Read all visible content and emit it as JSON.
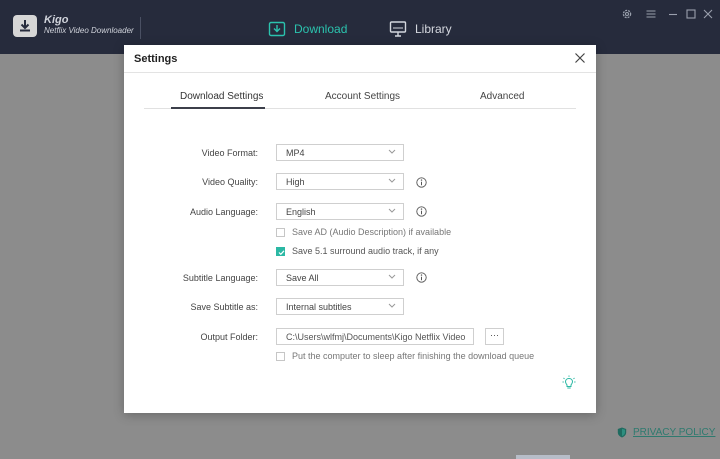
{
  "app": {
    "brand_name": "Kigo",
    "brand_subtitle": "Netflix Video Downloader",
    "accent_color": "#2bc3ae"
  },
  "nav": {
    "download_label": "Download",
    "library_label": "Library",
    "active": "Download"
  },
  "window_controls": [
    "settings-icon",
    "menu-icon",
    "minimize-icon",
    "maximize-icon",
    "close-icon"
  ],
  "privacy": {
    "label": "PRIVACY POLICY"
  },
  "dialog": {
    "title": "Settings",
    "tabs": [
      {
        "label": "Download Settings",
        "active": true
      },
      {
        "label": "Account Settings",
        "active": false
      },
      {
        "label": "Advanced",
        "active": false
      }
    ],
    "fields": {
      "video_format": {
        "label": "Video Format:",
        "value": "MP4"
      },
      "video_quality": {
        "label": "Video Quality:",
        "value": "High"
      },
      "audio_language": {
        "label": "Audio Language:",
        "value": "English"
      },
      "save_ad": {
        "label": "Save AD (Audio Description) if available",
        "checked": false
      },
      "save_51": {
        "label": "Save 5.1 surround audio track, if any",
        "checked": true
      },
      "subtitle_language": {
        "label": "Subtitle Language:",
        "value": "Save All"
      },
      "save_subtitle_as": {
        "label": "Save Subtitle as:",
        "value": "Internal subtitles"
      },
      "output_folder": {
        "label": "Output Folder:",
        "value": "C:\\Users\\wlfmj\\Documents\\Kigo Netflix Video",
        "browse_label": "···"
      },
      "sleep": {
        "label": "Put the computer to sleep after finishing the download queue",
        "checked": false
      }
    }
  }
}
